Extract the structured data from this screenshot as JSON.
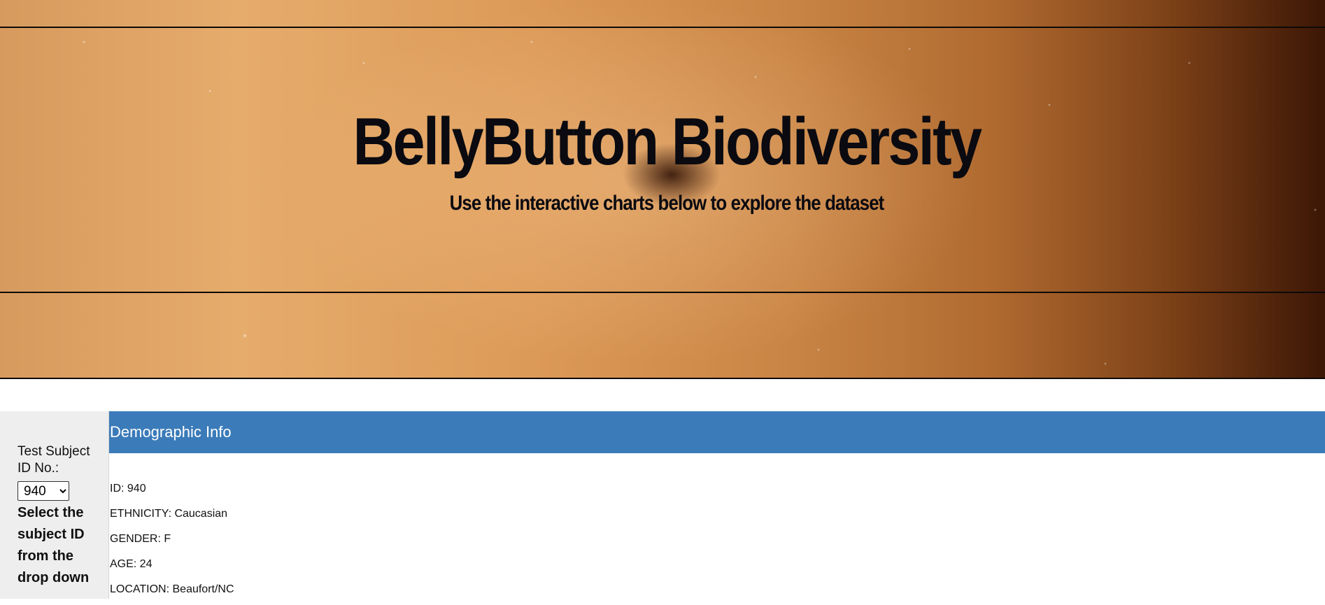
{
  "header": {
    "title": "BellyButton Biodiversity",
    "subtitle": "Use the interactive charts below to explore the dataset"
  },
  "selector": {
    "label": "Test Subject ID No.:",
    "selected_value": "940",
    "help_text": "Select the subject ID from the drop down"
  },
  "demographics": {
    "heading": "Demographic Info",
    "lines": [
      "ID: 940",
      "ETHNICITY: Caucasian",
      "GENDER: F",
      "AGE: 24",
      "LOCATION: Beaufort/NC"
    ]
  },
  "colors": {
    "panel_heading": "#3b7bb9",
    "sidebar_bg": "#eeeeee"
  }
}
